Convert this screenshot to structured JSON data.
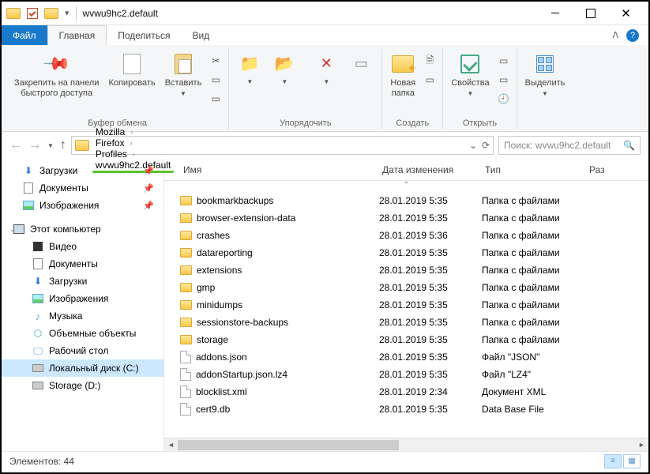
{
  "window": {
    "title": "wvwu9hc2.default"
  },
  "tabs": {
    "file": "Файл",
    "home": "Главная",
    "share": "Поделиться",
    "view": "Вид"
  },
  "ribbon": {
    "pin": "Закрепить на панели\nбыстрого доступа",
    "copy": "Копировать",
    "paste": "Вставить",
    "g_clipboard": "Буфер обмена",
    "g_organize": "Упорядочить",
    "newfolder": "Новая\nпапка",
    "g_create": "Создать",
    "props": "Свойства",
    "g_open": "Открыть",
    "select": "Выделить"
  },
  "breadcrumbs": [
    "Mozilla",
    "Firefox",
    "Profiles",
    "wvwu9hc2.default"
  ],
  "search_placeholder": "Поиск: wvwu9hc2.default",
  "nav": {
    "quick": [
      {
        "label": "Загрузки",
        "icon": "dl",
        "pinned": true
      },
      {
        "label": "Документы",
        "icon": "doc",
        "pinned": true
      },
      {
        "label": "Изображения",
        "icon": "img",
        "pinned": true
      }
    ],
    "pc_label": "Этот компьютер",
    "pc": [
      {
        "label": "Видео",
        "icon": "vid"
      },
      {
        "label": "Документы",
        "icon": "doc"
      },
      {
        "label": "Загрузки",
        "icon": "dl"
      },
      {
        "label": "Изображения",
        "icon": "img"
      },
      {
        "label": "Музыка",
        "icon": "mus"
      },
      {
        "label": "Объемные объекты",
        "icon": "3d"
      },
      {
        "label": "Рабочий стол",
        "icon": "desk"
      },
      {
        "label": "Локальный диск (C:)",
        "icon": "disk",
        "selected": true
      },
      {
        "label": "Storage (D:)",
        "icon": "disk"
      }
    ]
  },
  "columns": {
    "name": "Имя",
    "date": "Дата изменения",
    "type": "Тип",
    "size": "Раз"
  },
  "files": [
    {
      "name": "bookmarkbackups",
      "date": "28.01.2019 5:35",
      "type": "Папка с файлами",
      "icon": "fold"
    },
    {
      "name": "browser-extension-data",
      "date": "28.01.2019 5:35",
      "type": "Папка с файлами",
      "icon": "fold"
    },
    {
      "name": "crashes",
      "date": "28.01.2019 5:36",
      "type": "Папка с файлами",
      "icon": "fold"
    },
    {
      "name": "datareporting",
      "date": "28.01.2019 5:35",
      "type": "Папка с файлами",
      "icon": "fold"
    },
    {
      "name": "extensions",
      "date": "28.01.2019 5:35",
      "type": "Папка с файлами",
      "icon": "fold"
    },
    {
      "name": "gmp",
      "date": "28.01.2019 5:35",
      "type": "Папка с файлами",
      "icon": "fold"
    },
    {
      "name": "minidumps",
      "date": "28.01.2019 5:35",
      "type": "Папка с файлами",
      "icon": "fold"
    },
    {
      "name": "sessionstore-backups",
      "date": "28.01.2019 5:35",
      "type": "Папка с файлами",
      "icon": "fold"
    },
    {
      "name": "storage",
      "date": "28.01.2019 5:35",
      "type": "Папка с файлами",
      "icon": "fold"
    },
    {
      "name": "addons.json",
      "date": "28.01.2019 5:35",
      "type": "Файл \"JSON\"",
      "icon": "file"
    },
    {
      "name": "addonStartup.json.lz4",
      "date": "28.01.2019 5:35",
      "type": "Файл \"LZ4\"",
      "icon": "file"
    },
    {
      "name": "blocklist.xml",
      "date": "28.01.2019 2:34",
      "type": "Документ XML",
      "icon": "file"
    },
    {
      "name": "cert9.db",
      "date": "28.01.2019 5:35",
      "type": "Data Base File",
      "icon": "file"
    }
  ],
  "status": "Элементов: 44"
}
